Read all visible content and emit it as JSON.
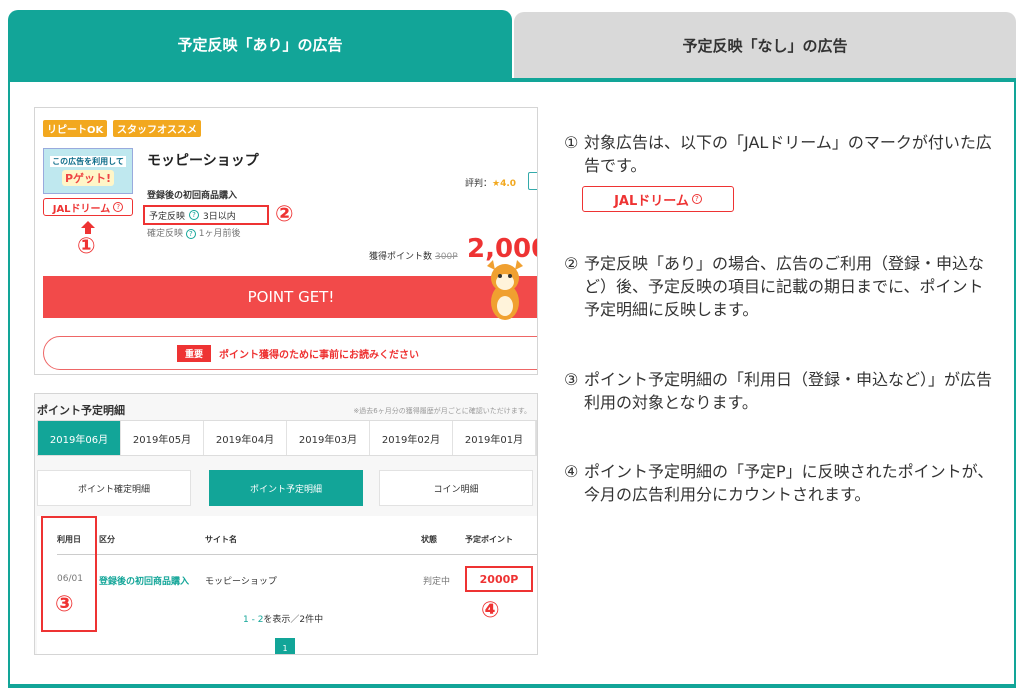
{
  "tabs": {
    "active_label": "予定反映「あり」の広告",
    "inactive_label": "予定反映「なし」の広告"
  },
  "colors": {
    "accent": "#12a598",
    "alert": "#e33333",
    "badge": "#f2a81f"
  },
  "ad_card": {
    "badges": [
      "リピートOK",
      "スタッフオススメ"
    ],
    "thumb_line1": "この広告を利用して",
    "thumb_line2": "Pゲット!",
    "shop_name": "モッピーショップ",
    "category": "登録後の初回商品購入",
    "jal_tag": "JALドリーム",
    "yotei_label": "予定反映",
    "yotei_value": "3日以内",
    "kakutei_label": "確定反映",
    "kakutei_value": "1ヶ月前後",
    "rating_label": "評判：",
    "rating_value": "★4.0",
    "points_label": "獲得ポイント数",
    "points_old": "300P",
    "points_new": "2,000",
    "button": "POINT GET!",
    "notice_chip": "重要",
    "notice_text": "ポイント獲得のために事前にお読みください",
    "marker1": "①",
    "marker2": "②"
  },
  "detail": {
    "title": "ポイント予定明細",
    "note": "※過去6ヶ月分の獲得履歴が月ごとに確認いただけます。",
    "months": [
      "2019年06月",
      "2019年05月",
      "2019年04月",
      "2019年03月",
      "2019年02月",
      "2019年01月"
    ],
    "subtabs": [
      "ポイント確定明細",
      "ポイント予定明細",
      "コイン明細"
    ],
    "columns": [
      "利用日",
      "区分",
      "サイト名",
      "状態",
      "予定ポイント"
    ],
    "row": {
      "date": "06/01",
      "kubun": "登録後の初回商品購入",
      "site": "モッピーショップ",
      "status": "判定中",
      "points": "2000P"
    },
    "paging_range": "1 - 2",
    "paging_text": "を表示／2件中",
    "page": "1",
    "marker3": "③",
    "marker4": "④"
  },
  "explanations": [
    {
      "bullet": "①",
      "text": "対象広告は、以下の「JALドリーム」のマークが付いた広告です。"
    },
    {
      "bullet": "②",
      "text": "予定反映「あり」の場合、広告のご利用（登録・申込など）後、予定反映の項目に記載の期日までに、ポイント予定明細に反映します。"
    },
    {
      "bullet": "③",
      "text": "ポイント予定明細の「利用日（登録・申込など）」が広告利用の対象となります。"
    },
    {
      "bullet": "④",
      "text": "ポイント予定明細の「予定P」に反映されたポイントが、今月の広告利用分にカウントされます。"
    }
  ],
  "jal_badge": "JALドリーム"
}
